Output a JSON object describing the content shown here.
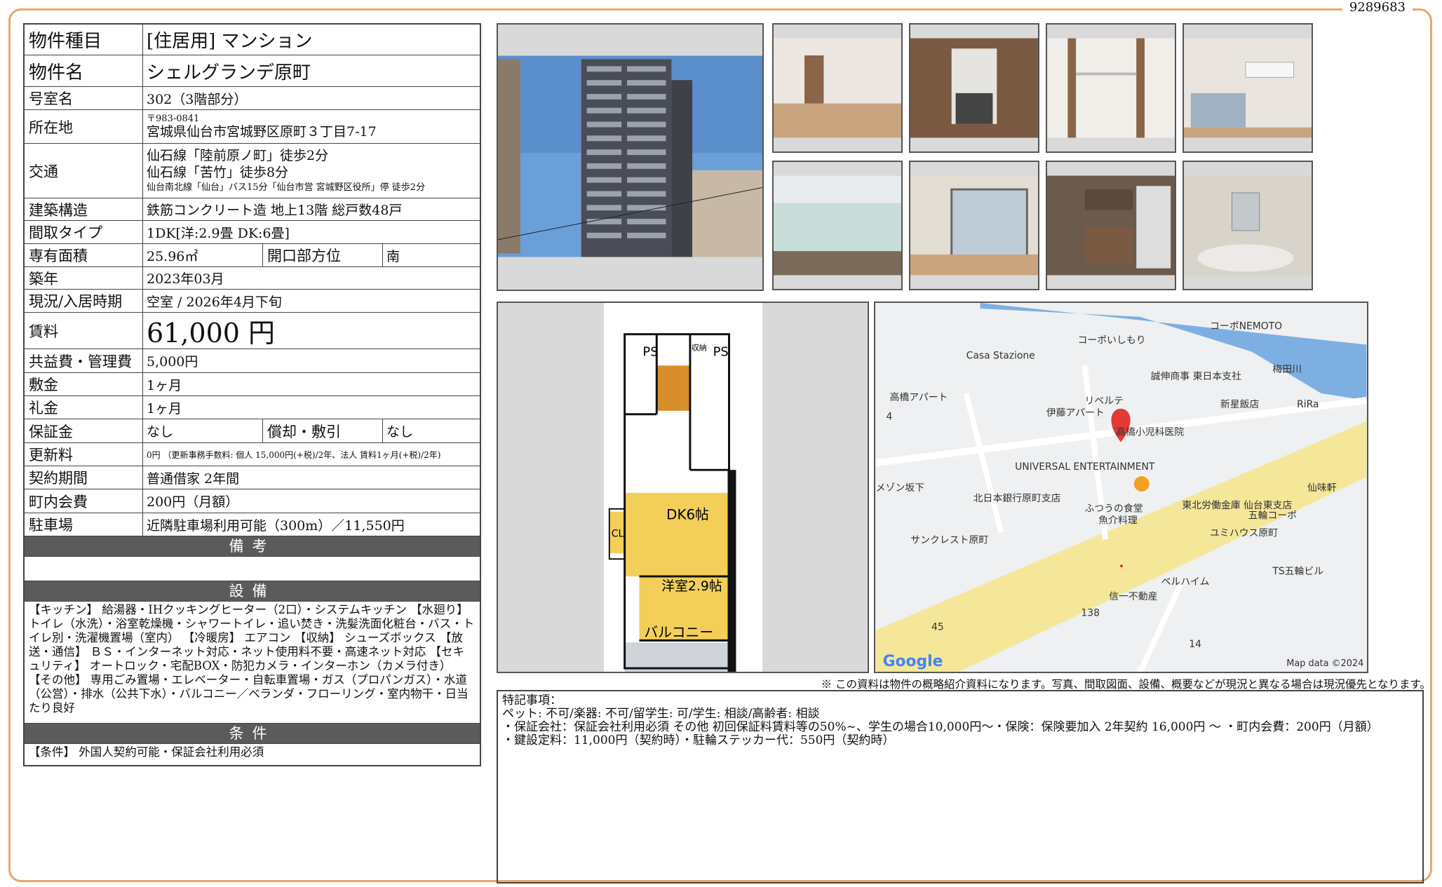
{
  "doc_id": "9289683",
  "property": {
    "type_label": "物件種目",
    "type_value": "[住居用] マンション",
    "name_label": "物件名",
    "name_value": "シェルグランデ原町",
    "room_label": "号室名",
    "room_value": "302（3階部分）",
    "address_label": "所在地",
    "postal": "〒983-0841",
    "address": "宮城県仙台市宮城野区原町３丁目7-17",
    "access_label": "交通",
    "access_1": "仙石線「陸前原ノ町」徒歩2分",
    "access_2": "仙石線「苦竹」徒歩8分",
    "access_3": "仙台南北線「仙台」バス15分「仙台市営 宮城野区役所」停 徒歩2分",
    "structure_label": "建築構造",
    "structure_value": "鉄筋コンクリート造 地上13階 総戸数48戸",
    "layout_label": "間取タイプ",
    "layout_value": "1DK[洋:2.9畳 DK:6畳]",
    "area_label": "専有面積",
    "area_value": "25.96㎡",
    "direction_label": "開口部方位",
    "direction_value": "南",
    "built_label": "築年",
    "built_value": "2023年03月",
    "status_label": "現況/入居時期",
    "status_value": "空室 / 2026年4月下旬",
    "rent_label": "賃料",
    "rent_value": "61,000 円",
    "fee_label": "共益費・管理費",
    "fee_value": "5,000円",
    "deposit_label": "敷金",
    "deposit_value": "1ヶ月",
    "key_label": "礼金",
    "key_value": "1ヶ月",
    "guarantee_label": "保証金",
    "guarantee_value": "なし",
    "amort_label": "償却・敷引",
    "amort_value": "なし",
    "renewal_label": "更新料",
    "renewal_value": "0円 （更新事務手数料: 個人 15,000円(+税)/2年、法人 賃料1ヶ月(+税)/2年)",
    "contract_label": "契約期間",
    "contract_value": "普通借家 2年間",
    "town_label": "町内会費",
    "town_value": "200円（月額）",
    "parking_label": "駐車場",
    "parking_value": "近隣駐車場利用可能（300m）／11,550円"
  },
  "sections": {
    "remarks_title": "備考",
    "equipment_title": "設備",
    "equipment_text": "【キッチン】 給湯器・IHクッキングヒーター（2口）・システムキッチン 【水廻り】 トイレ（水洗）・浴室乾燥機・シャワートイレ・追い焚き・洗髪洗面化粧台・バス・トイレ別・洗濯機置場（室内） 【冷暖房】 エアコン 【収納】 シューズボックス 【放送・通信】 ＢＳ・インターネット対応・ネット使用料不要・高速ネット対応 【セキュリティ】 オートロック・宅配BOX・防犯カメラ・インターホン（カメラ付き） 【その他】 専用ごみ置場・エレベーター・自転車置場・ガス（プロパンガス）・水道（公営）・排水（公共下水）・バルコニー／ベランダ・フローリング・室内物干・日当たり良好",
    "conditions_title": "条件",
    "conditions_text": "【条件】 外国人契約可能・保証会社利用必須"
  },
  "floorplan": {
    "ps1": "PS",
    "ps2": "PS",
    "shelf": "収納",
    "dk": "DK6帖",
    "western": "洋室2.9帖",
    "balcony": "バルコニー",
    "cl": "CL"
  },
  "map": {
    "labels": [
      "コーポNEMOTO",
      "コーポいしもり",
      "Casa Stazione",
      "誠伸商事 東日本支社",
      "梅田川",
      "高橋アパート",
      "リベルテ",
      "新星飯店",
      "RiRa",
      "伊藤アパート",
      "高橋小児科医院",
      "UNIVERSAL ENTERTAINMENT",
      "仙味軒",
      "メゾン坂下",
      "北日本銀行原町支店",
      "ふつうの食堂",
      "魚介料理",
      "東北労働金庫 仙台東支店",
      "五輪コーポ",
      "ユミハウス原町",
      "サンクレスト原町",
      "TS五輪ビル",
      "信一不動産",
      "ベルハイム",
      "138",
      "45",
      "14",
      "4"
    ],
    "logo": "Google",
    "copyright": "Map data ©2024"
  },
  "disclaimer": "※ この資料は物件の概略紹介資料になります。写真、間取図面、設備、概要などが現況と異なる場合は現況優先となります。",
  "notes": {
    "title": "特記事項：",
    "line1": "ペット: 不可/楽器: 不可/留学生: 可/学生: 相談/高齢者: 相談",
    "line2": "・保証会社：保証会社利用必須 その他 初回保証料賃料等の50%~、学生の場合10,000円～・保険：保険要加入 2年契約 16,000円 ～ ・町内会費：200円（月額）",
    "line3": "・鍵設定料：11,000円（契約時）・駐輪ステッカー代：550円（契約時）"
  },
  "colors": {
    "frame": "#e8a76a",
    "section_bg": "#5b5b5b",
    "plan_room": "#f3cf5a",
    "map_road": "#f5e79a",
    "map_river": "#6aa3df",
    "pin": "#e53935"
  }
}
